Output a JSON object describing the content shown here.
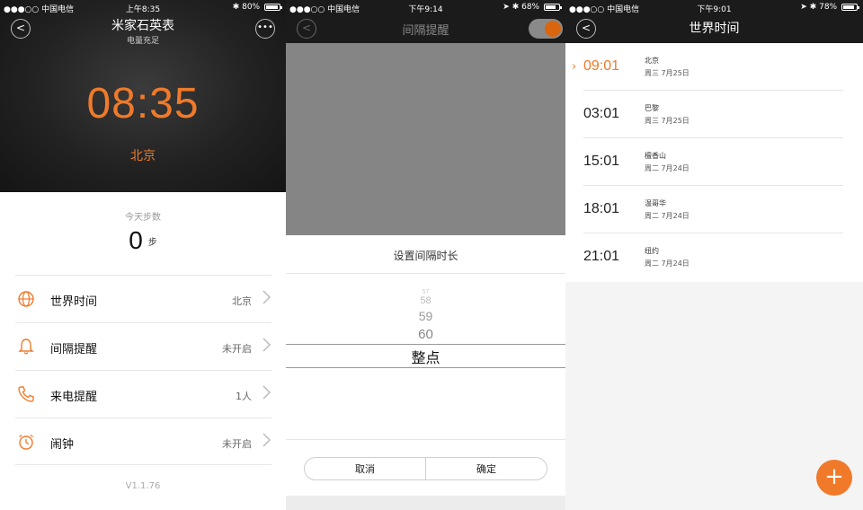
{
  "screen1": {
    "status": {
      "carrier": "●●●○○ 中国电信",
      "time": "上午8:35",
      "battery": "80%"
    },
    "title": "米家石英表",
    "subtitle": "电量充足",
    "clock": "08:35",
    "city": "北京",
    "steps": {
      "label": "今天步数",
      "value": "0",
      "unit": "步"
    },
    "menu": [
      {
        "label": "世界时间",
        "value": "北京",
        "icon": "globe-icon"
      },
      {
        "label": "间隔提醒",
        "value": "未开启",
        "icon": "bell-icon"
      },
      {
        "label": "来电提醒",
        "value": "1人",
        "icon": "phone-icon"
      },
      {
        "label": "闹钟",
        "value": "未开启",
        "icon": "alarm-clock-icon"
      }
    ],
    "version": "V1.1.76",
    "accent": "#f07a2a"
  },
  "screen2": {
    "status": {
      "carrier": "●●●○○ 中国电信",
      "time": "下午9:14",
      "battery": "68%"
    },
    "title": "间隔提醒",
    "toggle_on": true,
    "sheet_title": "设置间隔时长",
    "picker": [
      "57",
      "58",
      "59",
      "60"
    ],
    "picker_selected": "整点",
    "cancel_label": "取消",
    "confirm_label": "确定"
  },
  "screen3": {
    "status": {
      "carrier": "●●●○○ 中国电信",
      "time": "下午9:01",
      "battery": "78%"
    },
    "title": "世界时间",
    "cities": [
      {
        "time": "09:01",
        "name": "北京",
        "date": "周三  7月25日",
        "current": true
      },
      {
        "time": "03:01",
        "name": "巴黎",
        "date": "周三  7月25日",
        "current": false
      },
      {
        "time": "15:01",
        "name": "檀香山",
        "date": "周二  7月24日",
        "current": false
      },
      {
        "time": "18:01",
        "name": "温哥华",
        "date": "周二  7月24日",
        "current": false
      },
      {
        "time": "21:01",
        "name": "纽约",
        "date": "周二  7月24日",
        "current": false
      }
    ],
    "add_label": "+"
  }
}
